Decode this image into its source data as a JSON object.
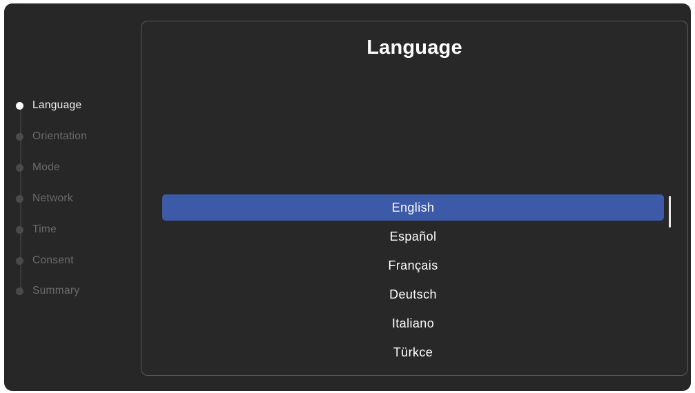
{
  "steps": [
    {
      "label": "Language",
      "active": true
    },
    {
      "label": "Orientation",
      "active": false
    },
    {
      "label": "Mode",
      "active": false
    },
    {
      "label": "Network",
      "active": false
    },
    {
      "label": "Time",
      "active": false
    },
    {
      "label": "Consent",
      "active": false
    },
    {
      "label": "Summary",
      "active": false
    }
  ],
  "panel": {
    "title": "Language"
  },
  "languages": {
    "selected": "English",
    "items": [
      "English",
      "Español",
      "Français",
      "Deutsch",
      "Italiano",
      "Türkçe"
    ]
  },
  "colors": {
    "background": "#272727",
    "selection": "#3d5aa8",
    "text_active": "#f2f2f2",
    "text_inactive": "#6b6b6b"
  }
}
